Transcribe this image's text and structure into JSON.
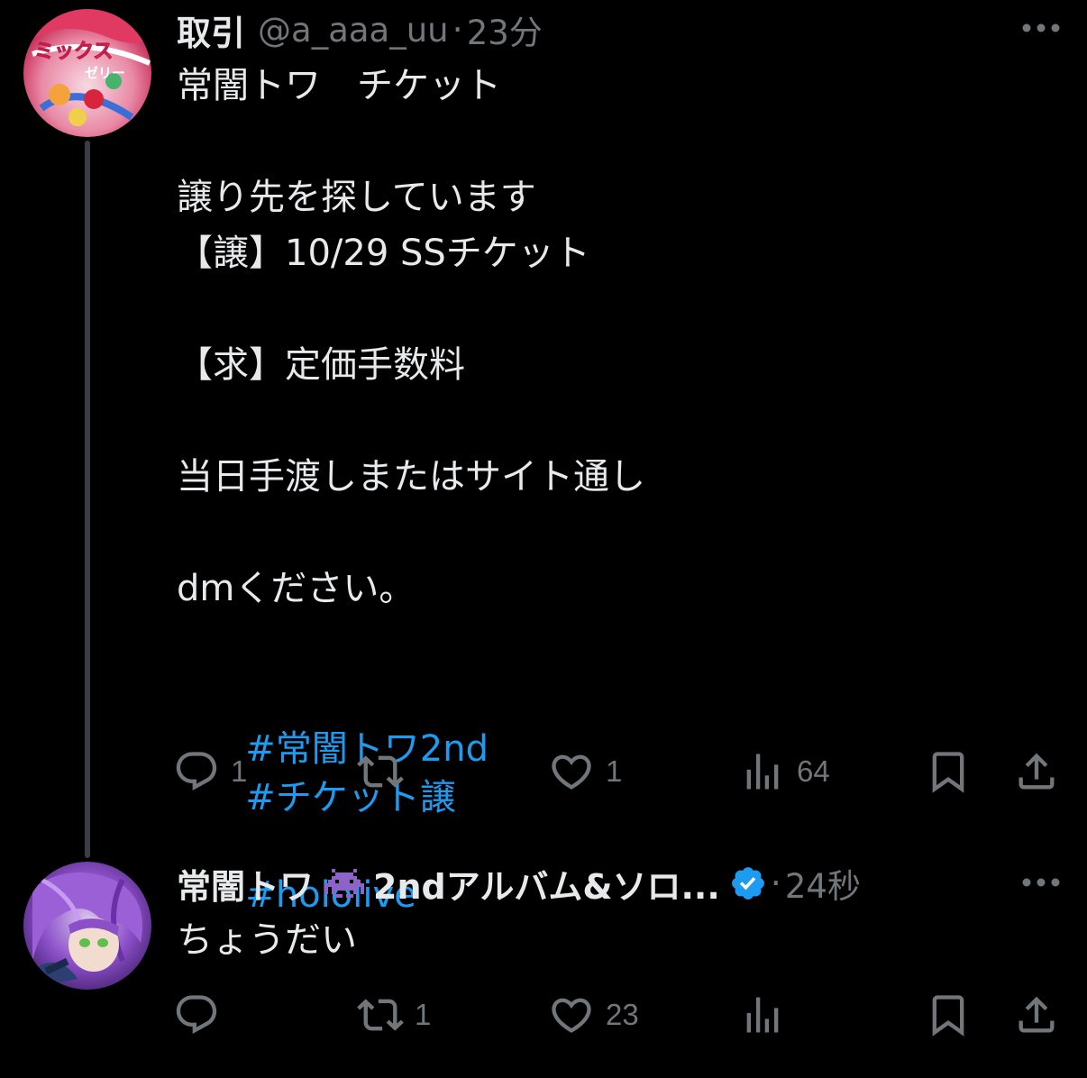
{
  "tweets": [
    {
      "display_name": "取引",
      "handle": "@a_aaa_uu",
      "separator": "·",
      "time": "23分",
      "avatar_label": "ミックスゼリー",
      "lines": [
        "常闇トワ　チケット",
        "",
        "譲り先を探しています",
        "【譲】10/29 SSチケット",
        "",
        "【求】定価手数料",
        "",
        "当日手渡しまたはサイト通し",
        "",
        "dmください。",
        ""
      ],
      "hashtags": [
        "#常闇トワ2nd",
        "#チケット譲",
        "#hololive"
      ],
      "actions": {
        "reply": "1",
        "retweet": "",
        "like": "1",
        "views": "64"
      }
    },
    {
      "display_name": "常闇トワ",
      "display_name_suffix": "2ndアルバム&ソロ...",
      "separator": "·",
      "time": "24秒",
      "lines": [
        "ちょうだい"
      ],
      "actions": {
        "reply": "",
        "retweet": "1",
        "like": "23",
        "views": ""
      }
    }
  ],
  "icons": {
    "more": "more-horizontal-icon",
    "reply": "reply-bubble-icon",
    "retweet": "retweet-arrows-icon",
    "like": "heart-icon",
    "views": "bar-chart-icon",
    "bookmark": "bookmark-icon",
    "share": "share-upload-icon",
    "verified": "verified-badge-icon",
    "emoji": "space-invader-emoji-icon"
  },
  "colors": {
    "background": "#000000",
    "text": "#e7e9ea",
    "muted": "#71767b",
    "link": "#1d9bf0",
    "verified": "#1d9bf0",
    "emoji": "#8e63c7"
  }
}
